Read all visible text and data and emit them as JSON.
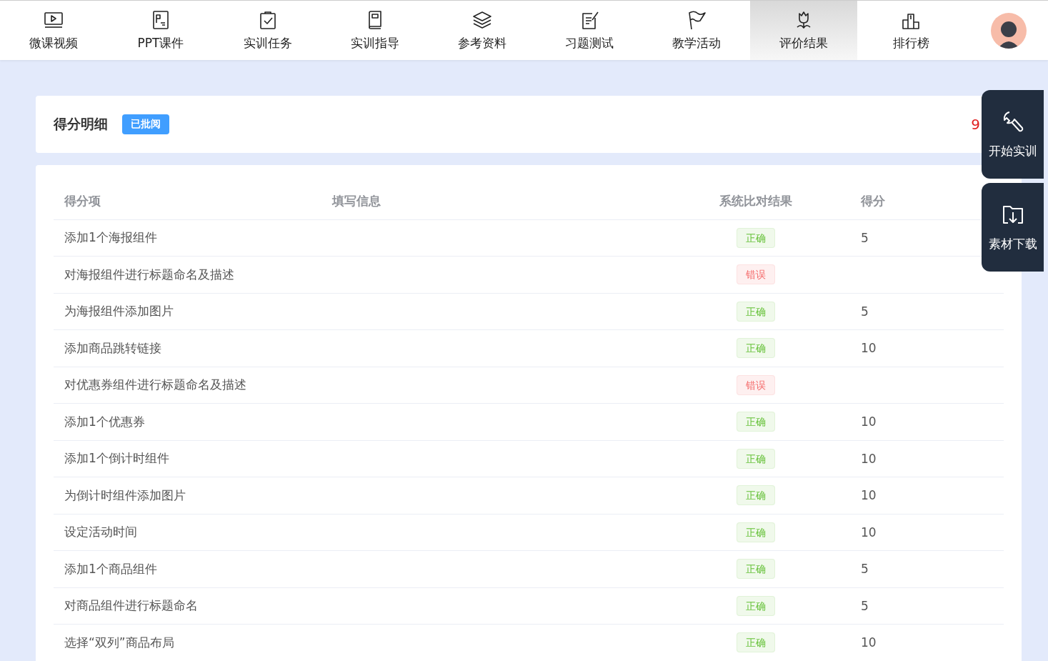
{
  "nav": {
    "tabs": [
      {
        "label": "微课视频",
        "selected": false
      },
      {
        "label": "PPT课件",
        "selected": false
      },
      {
        "label": "实训任务",
        "selected": false
      },
      {
        "label": "实训指导",
        "selected": false
      },
      {
        "label": "参考资料",
        "selected": false
      },
      {
        "label": "习题测试",
        "selected": false
      },
      {
        "label": "教学活动",
        "selected": false
      },
      {
        "label": "评价结果",
        "selected": true
      },
      {
        "label": "排行榜",
        "selected": false
      }
    ]
  },
  "summary": {
    "title": "得分明细",
    "badge": "已批阅",
    "score": "9"
  },
  "table": {
    "columns": [
      "得分项",
      "填写信息",
      "系统比对结果",
      "得分"
    ],
    "rows": [
      {
        "item": "添加1个海报组件",
        "result": "正确",
        "kind": "correct",
        "score": "5"
      },
      {
        "item": "对海报组件进行标题命名及描述",
        "result": "错误",
        "kind": "wrong"
      },
      {
        "item": "为海报组件添加图片",
        "result": "正确",
        "kind": "correct",
        "score": "5"
      },
      {
        "item": "添加商品跳转链接",
        "result": "正确",
        "kind": "correct",
        "score": "10"
      },
      {
        "item": "对优惠券组件进行标题命名及描述",
        "result": "错误",
        "kind": "wrong"
      },
      {
        "item": "添加1个优惠券",
        "result": "正确",
        "kind": "correct",
        "score": "10"
      },
      {
        "item": "添加1个倒计时组件",
        "result": "正确",
        "kind": "correct",
        "score": "10"
      },
      {
        "item": "为倒计时组件添加图片",
        "result": "正确",
        "kind": "correct",
        "score": "10"
      },
      {
        "item": "设定活动时间",
        "result": "正确",
        "kind": "correct",
        "score": "10"
      },
      {
        "item": "添加1个商品组件",
        "result": "正确",
        "kind": "correct",
        "score": "5"
      },
      {
        "item": "对商品组件进行标题命名",
        "result": "正确",
        "kind": "correct",
        "score": "5"
      },
      {
        "item": "选择“双列”商品布局",
        "result": "正确",
        "kind": "correct",
        "score": "10"
      }
    ]
  },
  "float_buttons": [
    {
      "label": "开始实训"
    },
    {
      "label": "素材下载"
    }
  ]
}
